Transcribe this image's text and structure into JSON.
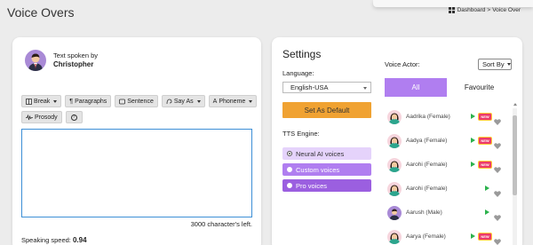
{
  "page": {
    "title": "Voice Overs"
  },
  "breadcrumb": {
    "home": "Dashboard",
    "separator": ">",
    "current": "Voice Over"
  },
  "speaker": {
    "label": "Text spoken by",
    "name": "Christopher"
  },
  "toolbar": {
    "buttons": [
      {
        "label": "Break",
        "icon": "break-icon",
        "dropdown": true
      },
      {
        "label": "Paragraphs",
        "icon": "paragraph-icon",
        "dropdown": false
      },
      {
        "label": "Sentence",
        "icon": "sentence-icon",
        "dropdown": false
      },
      {
        "label": "Say As",
        "icon": "say-as-icon",
        "dropdown": true
      },
      {
        "label": "Phoneme",
        "icon": "phoneme-icon",
        "dropdown": true
      },
      {
        "label": "Prosody",
        "icon": "prosody-icon",
        "dropdown": false
      },
      {
        "label": "?",
        "icon": "help-icon",
        "dropdown": false
      }
    ]
  },
  "editor": {
    "value": "",
    "chars_left": "3000 character's left."
  },
  "speed": {
    "label": "Speaking speed:",
    "value": "0.94"
  },
  "settings": {
    "title": "Settings",
    "language_label": "Language:",
    "language_value": "English-USA",
    "default_button": "Set As Default",
    "engine_label": "TTS Engine:",
    "engines": [
      {
        "label": "Neural AI voices",
        "selected": true
      },
      {
        "label": "Custom voices",
        "selected": false
      },
      {
        "label": "Pro voices",
        "selected": false
      }
    ]
  },
  "voice_actor": {
    "label": "Voice Actor:",
    "sort_label": "Sort By",
    "tabs": [
      "All",
      "Favourite"
    ],
    "actors": [
      {
        "name": "Aadrika (Female)",
        "badge": true,
        "gender": "female"
      },
      {
        "name": "Aadya (Female)",
        "badge": true,
        "gender": "female"
      },
      {
        "name": "Aarohi (Female)",
        "badge": true,
        "gender": "female"
      },
      {
        "name": "Aarohi (Female)",
        "badge": false,
        "gender": "female"
      },
      {
        "name": "Aarush (Male)",
        "badge": false,
        "gender": "male"
      },
      {
        "name": "Aarya (Female)",
        "badge": true,
        "gender": "female"
      }
    ],
    "badge_text": "NEW"
  },
  "colors": {
    "accent_purple": "#b07ef0",
    "engine_selected_bg": "#e5d3fb",
    "engine_bg": "#9b5fe0",
    "default_button_bg": "#f0a232",
    "play_green": "#2bb24c",
    "textbox_border": "#3d8fd6"
  }
}
